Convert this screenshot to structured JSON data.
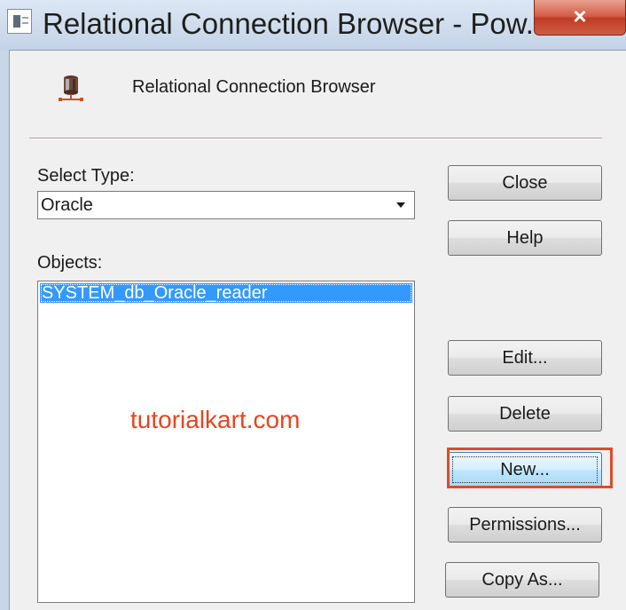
{
  "window": {
    "title": "Relational Connection Browser - Pow...",
    "close_symbol": "×"
  },
  "header": {
    "label": "Relational Connection Browser",
    "icon": "database-icon"
  },
  "select_type": {
    "label": "Select Type:",
    "value": "Oracle"
  },
  "objects": {
    "label": "Objects:",
    "items": [
      "SYSTEM_db_Oracle_reader"
    ],
    "selected_index": 0
  },
  "watermark": "tutorialkart.com",
  "buttons": {
    "close": "Close",
    "help": "Help",
    "edit": "Edit...",
    "delete": "Delete",
    "new": "New...",
    "permissions": "Permissions...",
    "copy_as": "Copy As..."
  },
  "colors": {
    "selection": "#3399ff",
    "highlight": "#e04a2a",
    "watermark": "#e84421"
  }
}
